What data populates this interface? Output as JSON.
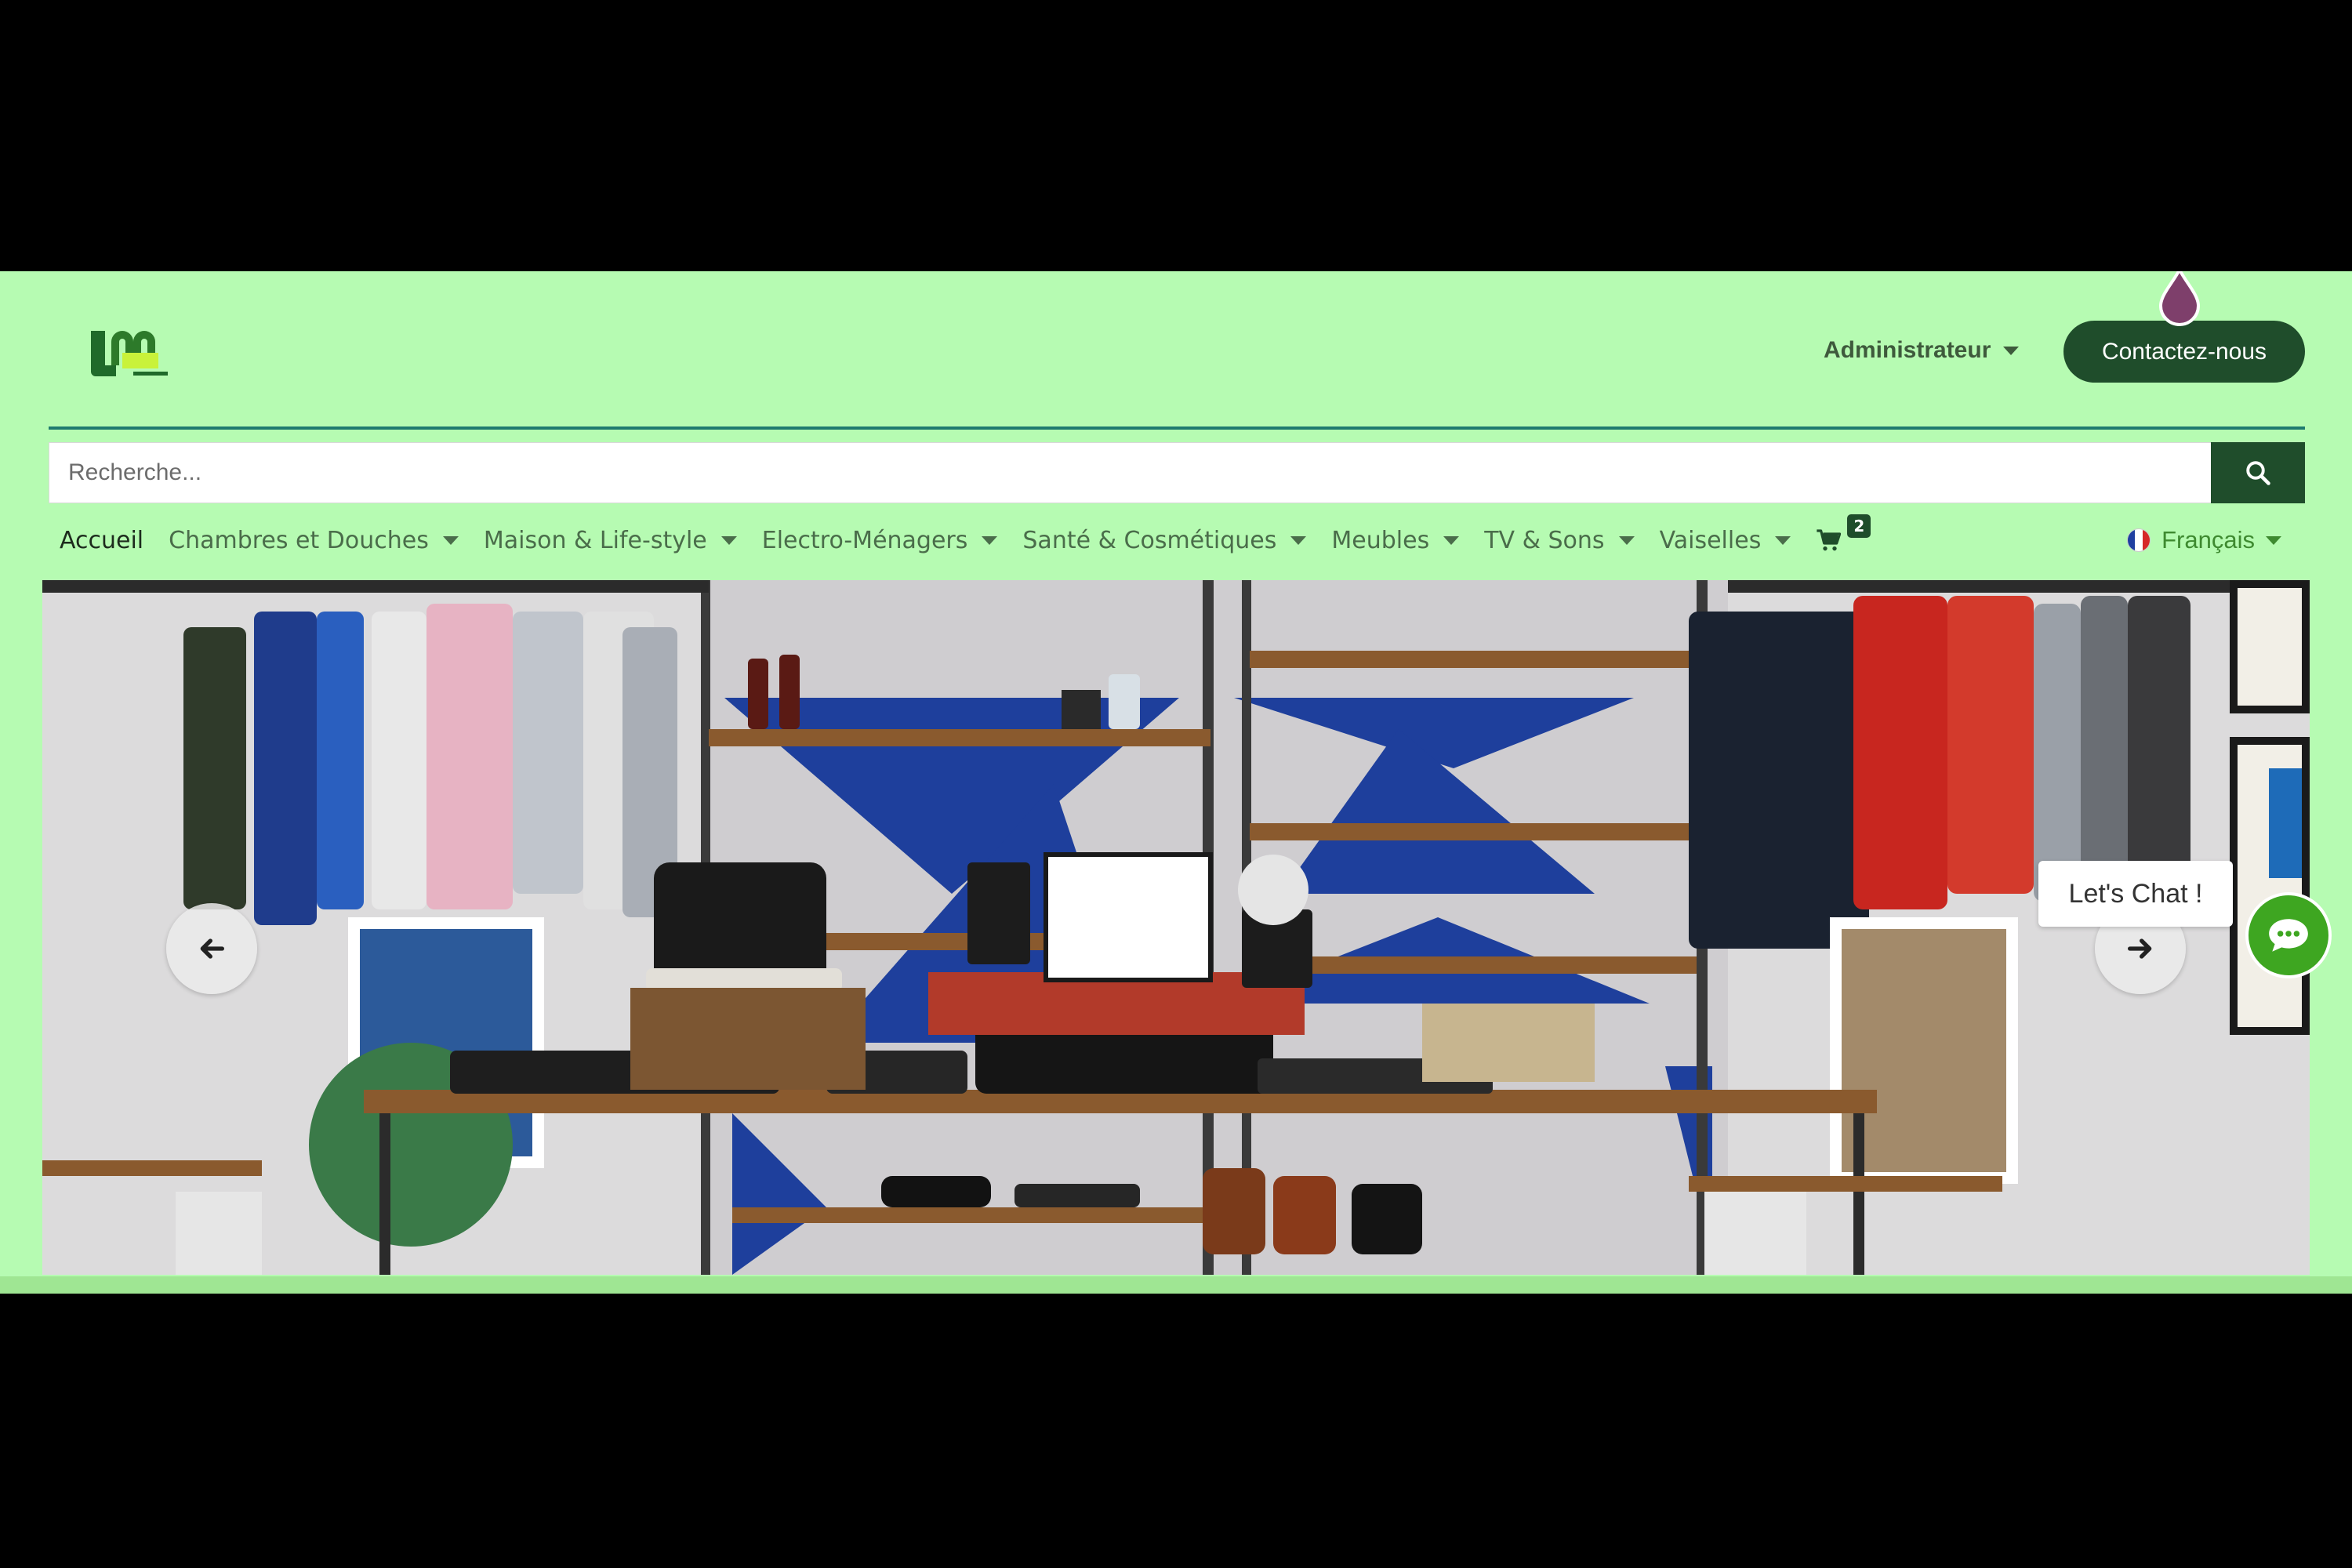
{
  "header": {
    "admin_label": "Administrateur",
    "contact_label": "Contactez-nous"
  },
  "search": {
    "placeholder": "Recherche...",
    "icon": "search-icon"
  },
  "nav": {
    "items": [
      {
        "label": "Accueil",
        "dropdown": false
      },
      {
        "label": "Chambres et Douches",
        "dropdown": true
      },
      {
        "label": "Maison & Life-style",
        "dropdown": true
      },
      {
        "label": "Electro-Ménagers",
        "dropdown": true
      },
      {
        "label": "Santé & Cosmétiques",
        "dropdown": true
      },
      {
        "label": "Meubles",
        "dropdown": true
      },
      {
        "label": "TV & Sons",
        "dropdown": true
      },
      {
        "label": "Vaiselles",
        "dropdown": true
      }
    ],
    "cart_count": "2",
    "language": "Français"
  },
  "hero": {
    "prev_icon": "arrow-left-icon",
    "next_icon": "arrow-right-icon"
  },
  "chat": {
    "bubble_text": "Let's Chat !"
  },
  "colors": {
    "header_bg": "#b6fbb2",
    "primary_dark_green": "#1f4d2b",
    "accent_green": "#3ea621"
  }
}
